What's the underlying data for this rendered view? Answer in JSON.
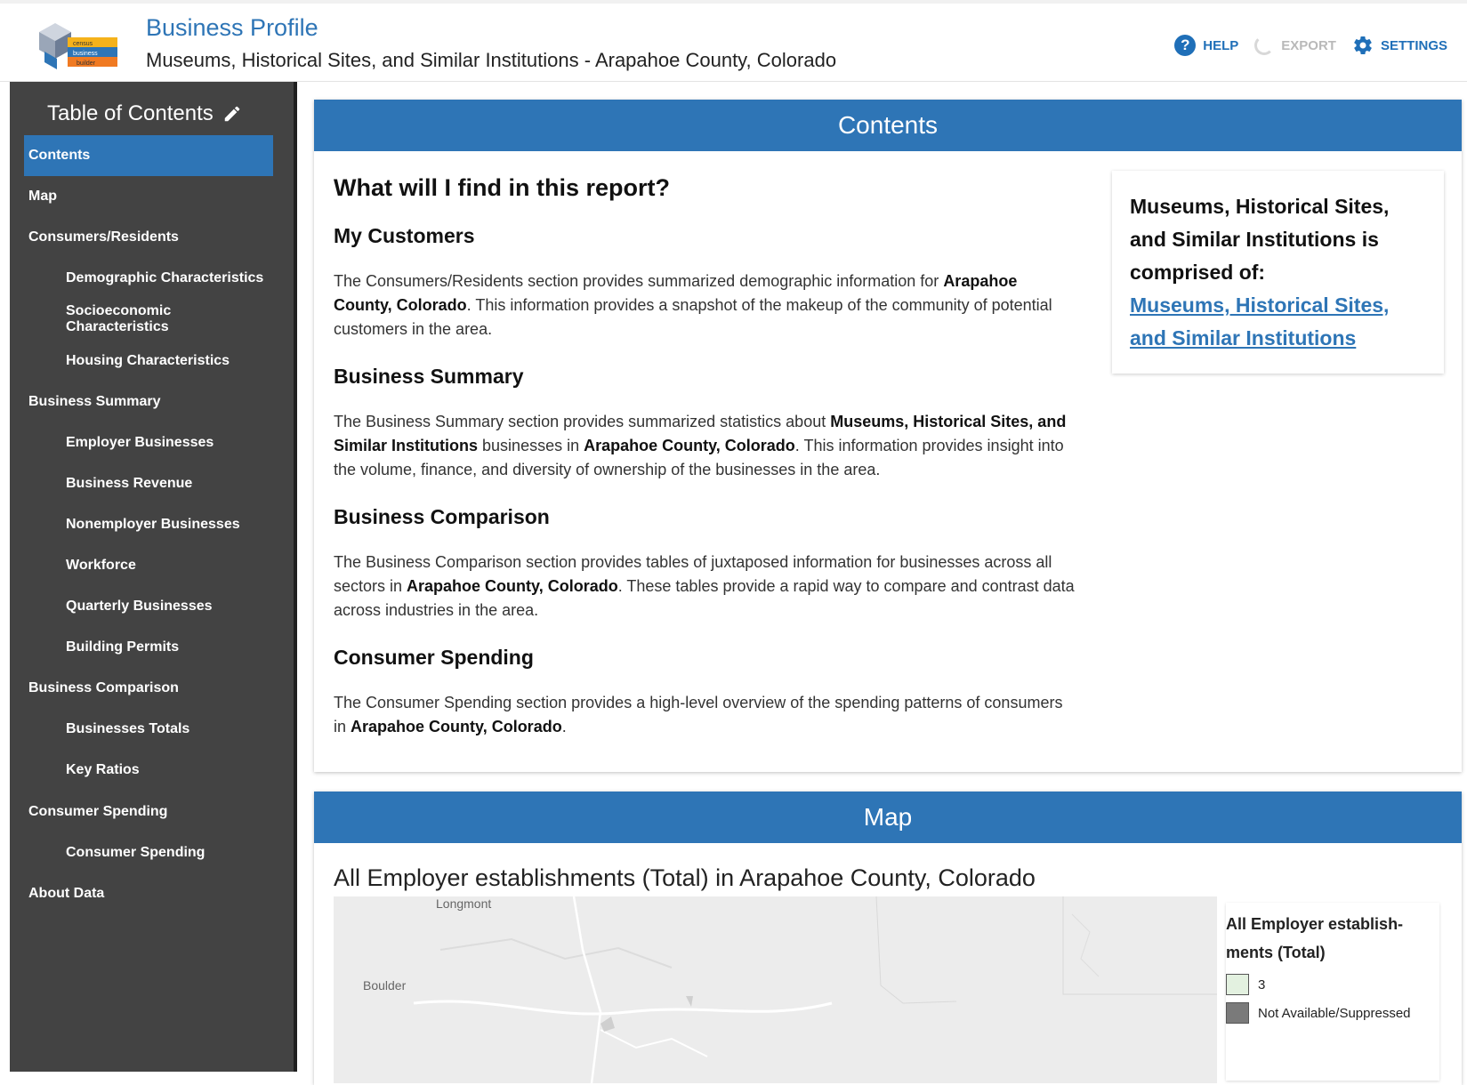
{
  "header": {
    "title": "Business Profile",
    "subtitle": "Museums, Historical Sites, and Similar Institutions - Arapahoe County, Colorado",
    "logo_text": [
      "census",
      "business",
      "builder"
    ],
    "actions": {
      "help": "HELP",
      "export": "EXPORT",
      "settings": "SETTINGS"
    }
  },
  "sidebar": {
    "title": "Table of Contents",
    "items": [
      {
        "label": "Contents",
        "level": 0,
        "active": true
      },
      {
        "label": "Map",
        "level": 0
      },
      {
        "label": "Consumers/Residents",
        "level": 0
      },
      {
        "label": "Demographic Characteristics",
        "level": 1
      },
      {
        "label": "Socioeconomic Characteristics",
        "level": 1
      },
      {
        "label": "Housing Characteristics",
        "level": 1
      },
      {
        "label": "Business Summary",
        "level": 0
      },
      {
        "label": "Employer Businesses",
        "level": 1
      },
      {
        "label": "Business Revenue",
        "level": 1
      },
      {
        "label": "Nonemployer Businesses",
        "level": 1
      },
      {
        "label": "Workforce",
        "level": 1
      },
      {
        "label": "Quarterly Businesses",
        "level": 1
      },
      {
        "label": "Building Permits",
        "level": 1
      },
      {
        "label": "Business Comparison",
        "level": 0
      },
      {
        "label": "Businesses Totals",
        "level": 1
      },
      {
        "label": "Key Ratios",
        "level": 1
      },
      {
        "label": "Consumer Spending",
        "level": 0
      },
      {
        "label": "Consumer Spending",
        "level": 1
      },
      {
        "label": "About Data",
        "level": 0
      }
    ]
  },
  "contents": {
    "heading": "Contents",
    "question": "What will I find in this report?",
    "sections": [
      {
        "title": "My Customers",
        "parts": [
          {
            "t": "The Consumers/Residents section provides summarized demographic information for "
          },
          {
            "t": "Arapahoe County, Colorado",
            "b": true
          },
          {
            "t": ". This information provides a snapshot of the makeup of the community of potential customers in the area."
          }
        ]
      },
      {
        "title": "Business Summary",
        "parts": [
          {
            "t": "The Business Summary section provides summarized statistics about "
          },
          {
            "t": "Museums, Historical Sites, and Similar Institutions",
            "b": true
          },
          {
            "t": " businesses in "
          },
          {
            "t": "Arapahoe County, Colorado",
            "b": true
          },
          {
            "t": ". This information provides insight into the volume, finance, and diversity of ownership of the businesses in the area."
          }
        ]
      },
      {
        "title": "Business Comparison",
        "parts": [
          {
            "t": "The Business Comparison section provides tables of juxtaposed information for businesses across all sectors in "
          },
          {
            "t": "Arapahoe County, Colorado",
            "b": true
          },
          {
            "t": ". These tables provide a rapid way to compare and contrast data across industries in the area."
          }
        ]
      },
      {
        "title": "Consumer Spending",
        "parts": [
          {
            "t": "The Consumer Spending section provides a high-level overview of the spending patterns of consumers in "
          },
          {
            "t": "Arapahoe County, Colorado",
            "b": true
          },
          {
            "t": "."
          }
        ]
      }
    ],
    "industry_card": {
      "text": "Museums, Historical Sites, and Similar Institutions is comprised of:",
      "link": "Museums, Historical Sites, and Similar Institutions"
    }
  },
  "map": {
    "heading": "Map",
    "title": "All Employer establishments (Total) in Arapahoe County, Colorado",
    "labels": [
      "Longmont",
      "Boulder"
    ],
    "legend": {
      "title": "All Employer establish-ments (Total)",
      "entries": [
        {
          "label": "3",
          "color": "#e3f1e0"
        },
        {
          "label": "Not Available/Suppressed",
          "color": "#7a7a7a"
        }
      ]
    }
  },
  "colors": {
    "accent": "#2e75b6",
    "sidebar": "#434343"
  }
}
